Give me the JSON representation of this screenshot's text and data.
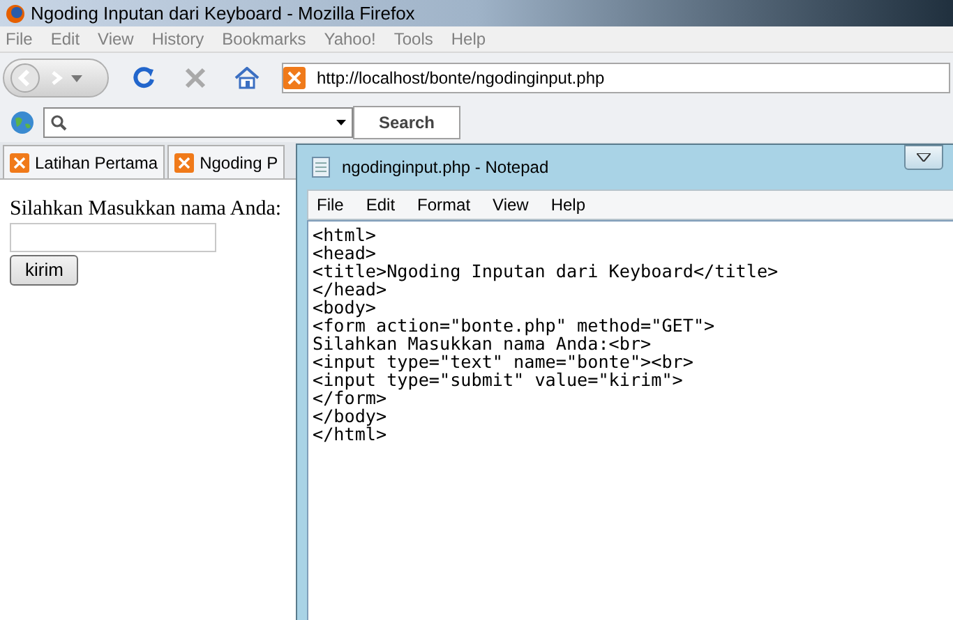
{
  "browser": {
    "title": "Ngoding Inputan dari Keyboard - Mozilla Firefox",
    "menu": [
      "File",
      "Edit",
      "View",
      "History",
      "Bookmarks",
      "Yahoo!",
      "Tools",
      "Help"
    ],
    "address": "http://localhost/bonte/ngodinginput.php",
    "search_button": "Search",
    "bookmarks": [
      {
        "label": "Latihan Pertama"
      },
      {
        "label": "Ngoding P"
      }
    ],
    "page": {
      "prompt": "Silahkan Masukkan nama Anda:",
      "submit": "kirim"
    }
  },
  "notepad": {
    "title": "ngodinginput.php - Notepad",
    "menu": [
      "File",
      "Edit",
      "Format",
      "View",
      "Help"
    ],
    "lines": [
      "<html>",
      "<head>",
      "<title>Ngoding Inputan dari Keyboard</title>",
      "</head>",
      "<body>",
      "<form action=\"bonte.php\" method=\"GET\">",
      "Silahkan Masukkan nama Anda:<br>",
      "<input type=\"text\" name=\"bonte\"><br>",
      "<input type=\"submit\" value=\"kirim\">",
      "</form>",
      "</body>",
      "</html>"
    ]
  }
}
